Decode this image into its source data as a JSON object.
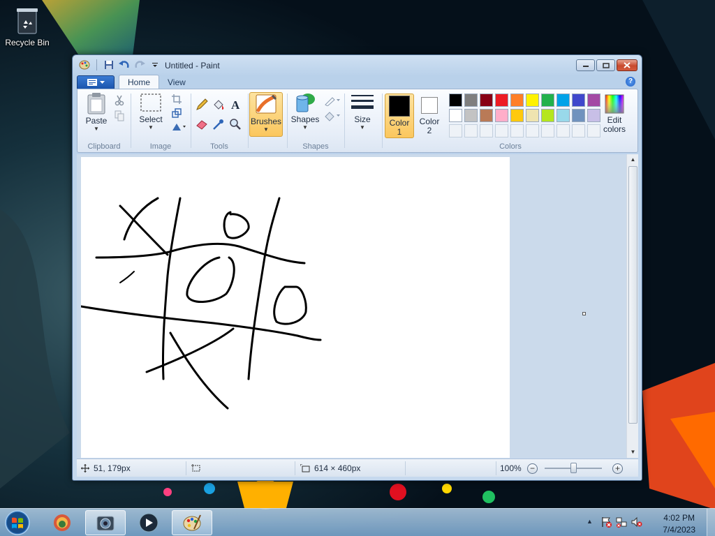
{
  "desktop": {
    "icons": [
      {
        "label": "Recycle Bin",
        "icon": "recycle-bin-icon"
      }
    ]
  },
  "window": {
    "title": "Untitled - Paint",
    "tabs": [
      {
        "label": "Home",
        "active": true
      },
      {
        "label": "View",
        "active": false
      }
    ]
  },
  "ribbon": {
    "groups": {
      "clipboard": {
        "label": "Clipboard",
        "paste_label": "Paste"
      },
      "image": {
        "label": "Image",
        "select_label": "Select"
      },
      "tools": {
        "label": "Tools"
      },
      "brushes": {
        "label": "Brushes"
      },
      "shapes": {
        "label": "Shapes",
        "shapes_label": "Shapes"
      },
      "size": {
        "label": "Size"
      },
      "colors": {
        "label": "Colors",
        "color1_label": "Color\n1",
        "color1_line1": "Color",
        "color1_line2": "1",
        "color2_line1": "Color",
        "color2_line2": "2",
        "edit_line1": "Edit",
        "edit_line2": "colors",
        "color1_value": "#000000",
        "color2_value": "#ffffff",
        "palette_row1": [
          "#000000",
          "#7f7f7f",
          "#880015",
          "#ed1c24",
          "#ff7f27",
          "#fff200",
          "#22b14c",
          "#00a2e8",
          "#3f48cc",
          "#a349a4"
        ],
        "palette_row2": [
          "#ffffff",
          "#c3c3c3",
          "#b97a57",
          "#ffaec9",
          "#ffc90e",
          "#efe4b0",
          "#b5e61d",
          "#99d9ea",
          "#7092be",
          "#c8bfe7"
        ],
        "custom_slots": 10
      }
    }
  },
  "statusbar": {
    "cursor_pos": "51, 179px",
    "selection_size": "",
    "canvas_size": "614 × 460px",
    "zoom": "100%",
    "zoom_percent": 100
  },
  "taskbar": {
    "items": [
      {
        "name": "start-button",
        "icon": "windows-logo-icon"
      },
      {
        "name": "taskbar-app-1",
        "icon": "app-shield-icon",
        "open": false
      },
      {
        "name": "taskbar-app-2",
        "icon": "camera-icon",
        "open": true
      },
      {
        "name": "taskbar-app-3",
        "icon": "media-player-icon",
        "open": false
      },
      {
        "name": "taskbar-paint",
        "icon": "paint-palette-icon",
        "open": true
      }
    ],
    "tray_expand": "▲",
    "time": "4:02 PM",
    "date": "7/4/2023"
  }
}
